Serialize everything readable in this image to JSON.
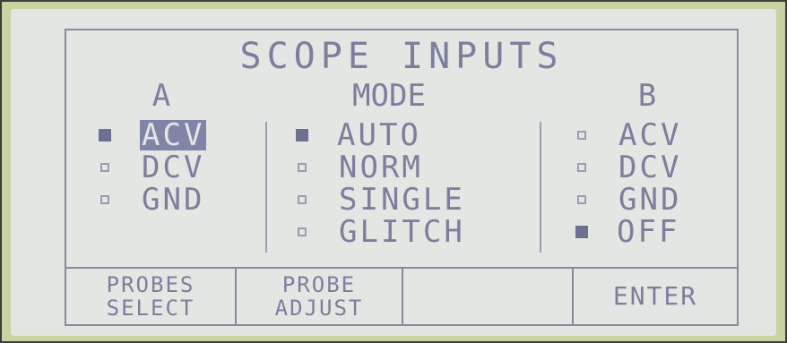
{
  "screen": {
    "title": "SCOPE INPUTS"
  },
  "columns": {
    "a": {
      "header": "A",
      "options": [
        {
          "label": "ACV",
          "selected": true
        },
        {
          "label": "DCV",
          "selected": false
        },
        {
          "label": "GND",
          "selected": false
        }
      ]
    },
    "mode": {
      "header": "MODE",
      "options": [
        {
          "label": "AUTO",
          "selected": true
        },
        {
          "label": "NORM",
          "selected": false
        },
        {
          "label": "SINGLE",
          "selected": false
        },
        {
          "label": "GLITCH",
          "selected": false
        }
      ]
    },
    "b": {
      "header": "B",
      "options": [
        {
          "label": "ACV",
          "selected": false
        },
        {
          "label": "DCV",
          "selected": false
        },
        {
          "label": "GND",
          "selected": false
        },
        {
          "label": "OFF",
          "selected": true
        }
      ]
    }
  },
  "softkeys": [
    {
      "line1": "PROBES",
      "line2": "SELECT"
    },
    {
      "line1": "PROBE",
      "line2": "ADJUST"
    },
    {
      "line1": "",
      "line2": ""
    },
    {
      "line1": "ENTER",
      "line2": ""
    }
  ],
  "colors": {
    "lcd_background": "#e4e6e4",
    "lcd_text": "#7c7f9c",
    "bezel": "#c9d2a1",
    "highlight": "#8084a6"
  }
}
